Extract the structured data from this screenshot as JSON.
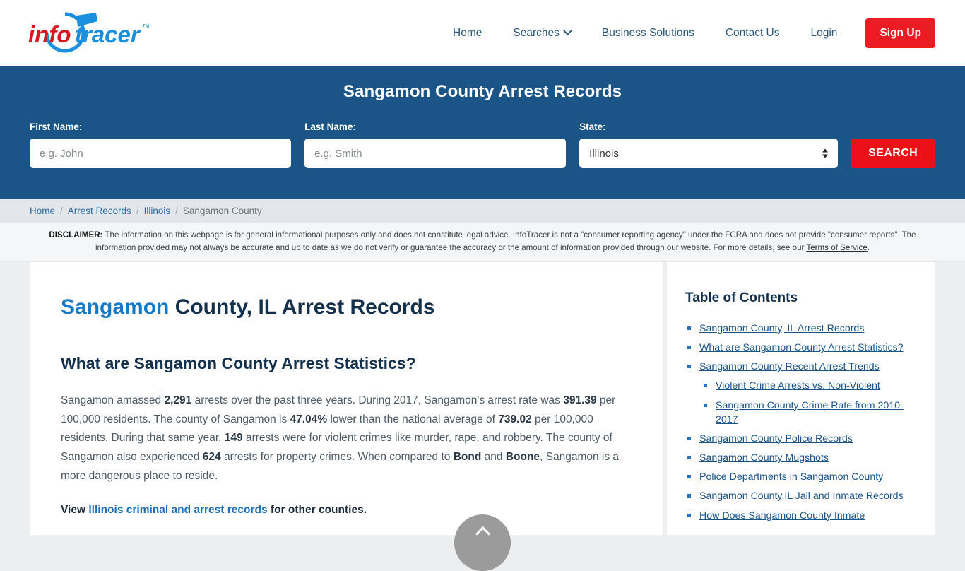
{
  "header": {
    "logo": {
      "part1": "info",
      "part2": "tracer",
      "tm": "™"
    },
    "nav": [
      {
        "label": "Home",
        "icon": null
      },
      {
        "label": "Searches",
        "icon": "chevron-down-icon"
      },
      {
        "label": "Business Solutions",
        "icon": null
      },
      {
        "label": "Contact Us",
        "icon": null
      },
      {
        "label": "Login",
        "icon": null
      }
    ],
    "signup_label": "Sign Up",
    "signup_color": "#ec1c24"
  },
  "banner": {
    "title": "Sangamon County Arrest Records",
    "bg_color": "#1b5587",
    "first_name": {
      "label": "First Name:",
      "placeholder": "e.g. John",
      "value": ""
    },
    "last_name": {
      "label": "Last Name:",
      "placeholder": "e.g. Smith",
      "value": ""
    },
    "state": {
      "label": "State:",
      "value": "Illinois"
    },
    "search_label": "SEARCH",
    "search_color": "#ec1118"
  },
  "breadcrumb": {
    "separator": "/",
    "items": [
      {
        "label": "Home",
        "current": false
      },
      {
        "label": "Arrest Records",
        "current": false
      },
      {
        "label": "Illinois",
        "current": false
      },
      {
        "label": "Sangamon County",
        "current": true
      }
    ]
  },
  "disclaimer": {
    "heading": "DISCLAIMER:",
    "text": " The information on this webpage is for general informational purposes only and does not constitute legal advice. InfoTracer is not a \"consumer reporting agency\" under the FCRA and does not provide \"consumer reports\". The information provided may not always be accurate and up to date as we do not verify or guarantee the accuracy or the amount of information provided through our website. For more details, see our ",
    "link": "Terms of Service",
    "suffix": "."
  },
  "main": {
    "title_accent": "Sangamon",
    "title_rest": " County, IL Arrest Records",
    "section_title": "What are Sangamon County Arrest Statistics?",
    "paragraph": {
      "s1": "Sangamon amassed ",
      "v1": "2,291",
      "s2": " arrests over the past three years. During 2017, Sangamon's arrest rate was ",
      "v2": "391.39",
      "s3": " per 100,000 residents. The county of Sangamon is ",
      "v3": "47.04%",
      "s4": " lower than the national average of ",
      "v4": "739.02",
      "s5": " per 100,000 residents. During that same year, ",
      "v5": "149",
      "s6": " arrests were for violent crimes like murder, rape, and robbery. The county of Sangamon also experienced ",
      "v6": "624",
      "s7": " arrests for property crimes. When compared to ",
      "v7": "Bond",
      "s8": " and ",
      "v8": "Boone",
      "s9": ", Sangamon is a more dangerous place to reside."
    },
    "view_prefix": "View ",
    "view_link": "Illinois criminal and arrest records",
    "view_suffix": " for other counties."
  },
  "toc": {
    "title": "Table of Contents",
    "items": [
      {
        "label": "Sangamon County, IL Arrest Records",
        "sub": false
      },
      {
        "label": "What are Sangamon County Arrest Statistics?",
        "sub": false
      },
      {
        "label": "Sangamon County Recent Arrest Trends",
        "sub": false
      },
      {
        "label": "Violent Crime Arrests vs. Non-Violent",
        "sub": true
      },
      {
        "label": "Sangamon County Crime Rate from 2010-2017",
        "sub": true
      },
      {
        "label": "Sangamon County Police Records",
        "sub": false
      },
      {
        "label": "Sangamon County Mugshots",
        "sub": false
      },
      {
        "label": "Police Departments in Sangamon County",
        "sub": false
      },
      {
        "label": "Sangamon County,IL Jail and Inmate Records",
        "sub": false
      },
      {
        "label": "How Does Sangamon County Inmate",
        "sub": false
      }
    ]
  },
  "scroll_top": {
    "icon": "chevron-up-icon"
  }
}
